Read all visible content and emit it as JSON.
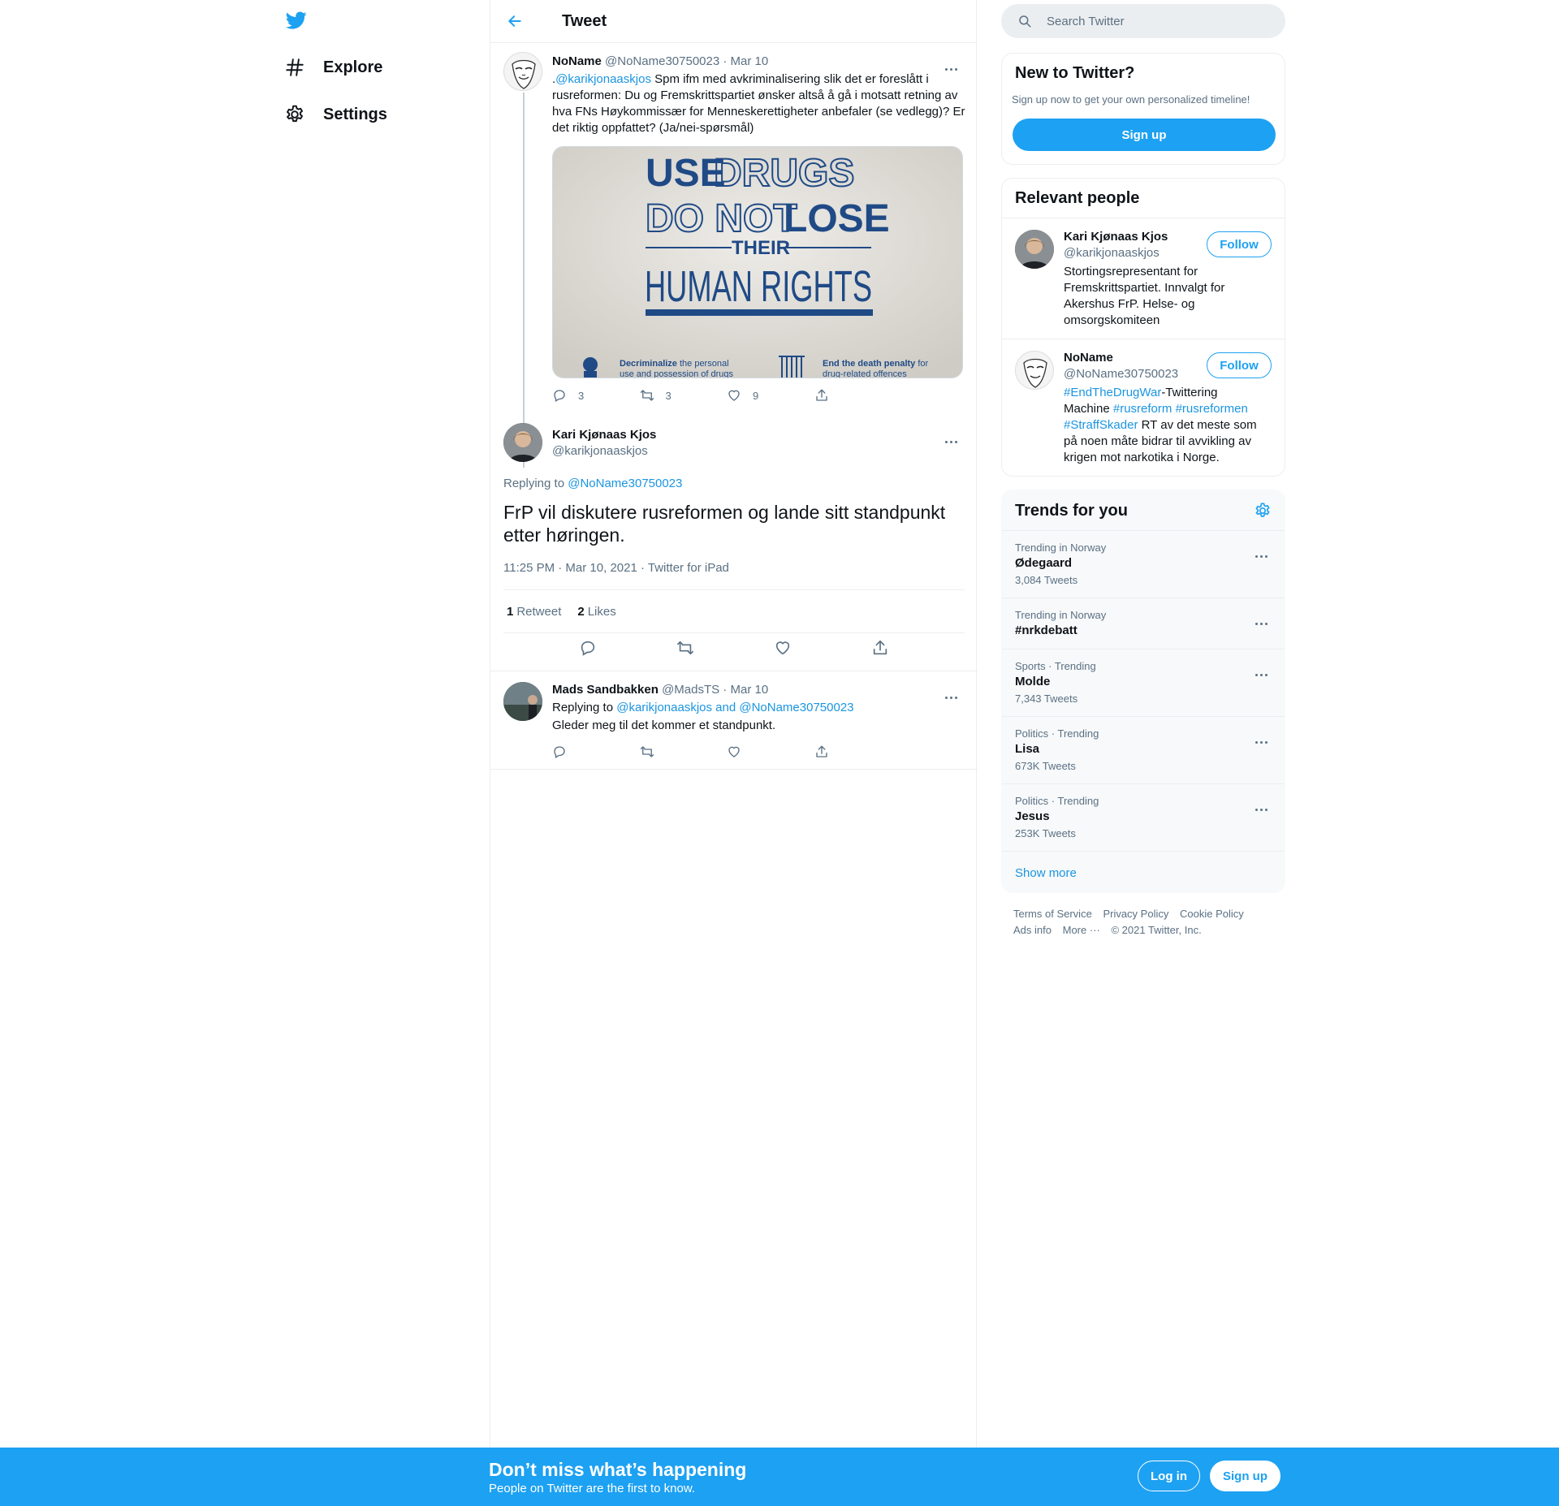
{
  "nav": {
    "explore": "Explore",
    "settings": "Settings"
  },
  "header": {
    "title": "Tweet"
  },
  "parent_tweet": {
    "name": "NoName",
    "handle": "@NoName30750023",
    "sep": " · ",
    "date": "Mar 10",
    "text_prefix": ".",
    "mention": "@karikjonaaskjos",
    "text": " Spm ifm med avkriminalisering slik det er foreslått i rusreformen: Du og Fremskrittspartiet ønsker altså å gå i motsatt retning av hva FNs Høykommissær for Menneskerettigheter anbefaler (se vedlegg)? Er det riktig oppfattet? (Ja/nei-spørsmål)",
    "media": {
      "line1a": "USE",
      "line1b": "DRUGS",
      "line2a": "DO NOT",
      "line2b": "LOSE",
      "line3": "THEIR",
      "line4": "HUMAN RIGHTS",
      "foot_left_bold": "Decriminalize",
      "foot_left": " the personal",
      "foot_left2": "use and possession of drugs",
      "foot_right_bold": "End the death penalty",
      "foot_right": " for",
      "foot_right2": "drug-related offences"
    },
    "replies": "3",
    "retweets": "3",
    "likes": "9"
  },
  "main_tweet": {
    "name": "Kari Kjønaas Kjos",
    "handle": "@karikjonaaskjos",
    "replying_label": "Replying to ",
    "replying_to": "@NoName30750023",
    "text": "FrP vil diskutere rusreformen og lande sitt standpunkt etter høringen.",
    "meta": "11:25 PM · Mar 10, 2021 · Twitter for iPad",
    "retweet_count": "1",
    "retweet_label": "Retweet",
    "like_count": "2",
    "like_label": "Likes"
  },
  "reply_tweet": {
    "name": "Mads Sandbakken",
    "handle": "@MadsTS",
    "sep": " · ",
    "date": "Mar 10",
    "replying_label": "Replying to ",
    "replying_to": "@karikjonaaskjos and @NoName30750023",
    "text": "Gleder meg til det kommer et standpunkt."
  },
  "search": {
    "placeholder": "Search Twitter"
  },
  "new_to_twitter": {
    "title": "New to Twitter?",
    "subtitle": "Sign up now to get your own personalized timeline!",
    "button": "Sign up"
  },
  "relevant_people": {
    "title": "Relevant people",
    "people": [
      {
        "name": "Kari Kjønaas Kjos",
        "handle": "@karikjonaaskjos",
        "follow": "Follow",
        "bio": "Stortingsrepresentant for Fremskrittspartiet. Innvalgt for Akershus FrP. Helse- og omsorgskomiteen"
      },
      {
        "name": "NoName",
        "handle": "@NoName30750023",
        "follow": "Follow",
        "bio_tag1": "#EndTheDrugWar",
        "bio_text1": "-Twittering Machine ",
        "bio_tag2": "#rusreform",
        "bio_tag3": "#rusreformen",
        "bio_tag4": "#StraffSkader",
        "bio_text2": " RT av det meste som på noen måte bidrar til avvikling av krigen mot narkotika i Norge."
      }
    ]
  },
  "trends": {
    "title": "Trends for you",
    "items": [
      {
        "context": "Trending in Norway",
        "name": "Ødegaard",
        "count": "3,084 Tweets"
      },
      {
        "context": "Trending in Norway",
        "name": "#nrkdebatt",
        "count": ""
      },
      {
        "context": "Sports · Trending",
        "name": "Molde",
        "count": "7,343 Tweets"
      },
      {
        "context": "Politics · Trending",
        "name": "Lisa",
        "count": "673K Tweets"
      },
      {
        "context": "Politics · Trending",
        "name": "Jesus",
        "count": "253K Tweets"
      }
    ],
    "show_more": "Show more"
  },
  "footer": {
    "terms": "Terms of Service",
    "privacy": "Privacy Policy",
    "cookie": "Cookie Policy",
    "ads": "Ads info",
    "more": "More ···",
    "copyright": "© 2021 Twitter, Inc."
  },
  "bottom_bar": {
    "title": "Don’t miss what’s happening",
    "subtitle": "People on Twitter are the first to know.",
    "login": "Log in",
    "signup": "Sign up"
  },
  "colors": {
    "accent": "#1da1f2",
    "link": "#1b95e0",
    "secondary_text": "#5b7083",
    "border": "#ebeef0"
  },
  "icons": [
    "twitter-bird-icon",
    "hashtag-icon",
    "gear-icon",
    "back-arrow-icon",
    "search-icon",
    "reply-icon",
    "retweet-icon",
    "like-icon",
    "share-icon",
    "more-icon"
  ]
}
